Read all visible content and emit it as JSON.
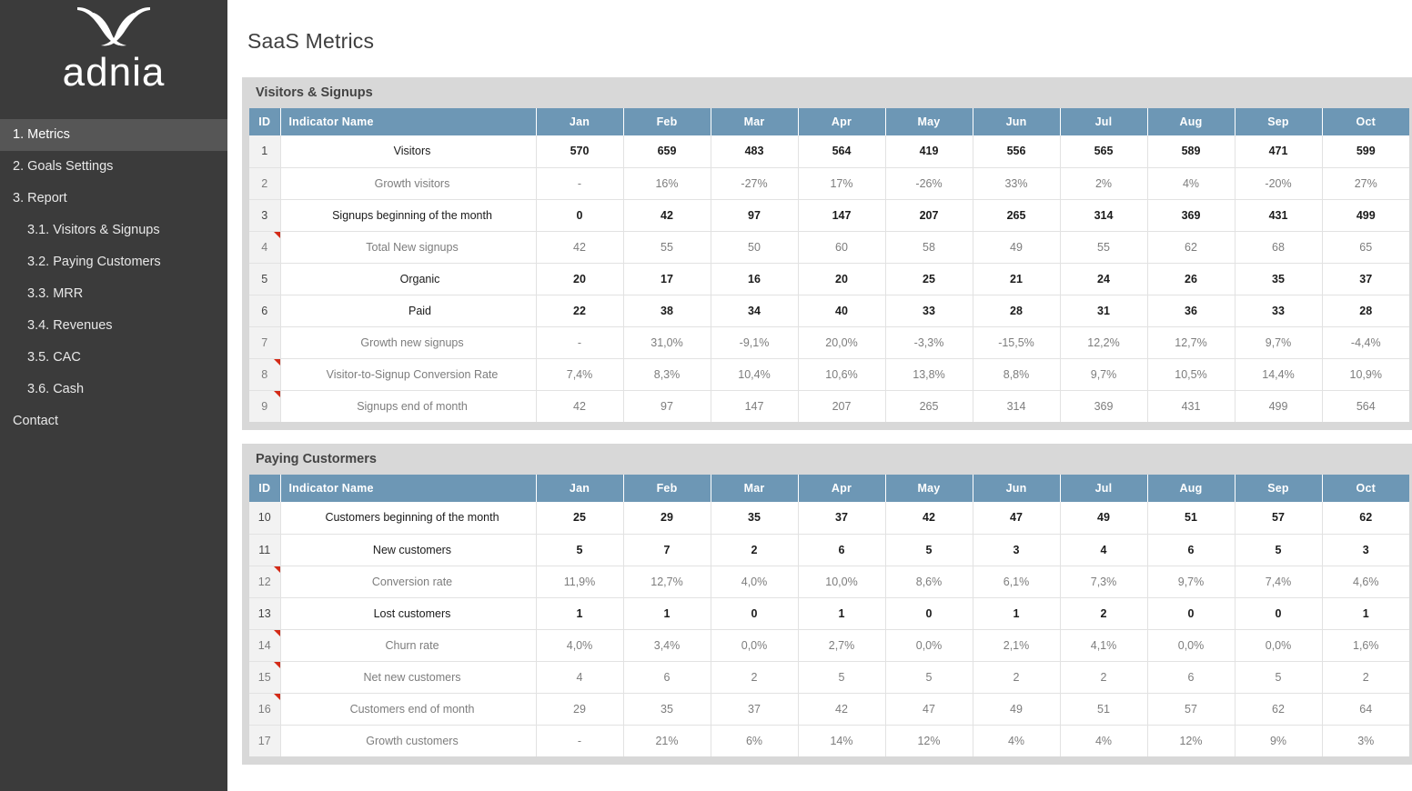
{
  "sidebar": {
    "brand": "adnia",
    "logo_icon": "adnia-ribbon-logo",
    "items": [
      {
        "label": "1. Metrics",
        "level": 0,
        "active": true
      },
      {
        "label": "2. Goals Settings",
        "level": 0,
        "active": false
      },
      {
        "label": "3. Report",
        "level": 0,
        "active": false
      },
      {
        "label": "3.1. Visitors & Signups",
        "level": 1,
        "active": false
      },
      {
        "label": "3.2. Paying Customers",
        "level": 1,
        "active": false
      },
      {
        "label": "3.3. MRR",
        "level": 1,
        "active": false
      },
      {
        "label": "3.4. Revenues",
        "level": 1,
        "active": false
      },
      {
        "label": "3.5. CAC",
        "level": 1,
        "active": false
      },
      {
        "label": "3.6. Cash",
        "level": 1,
        "active": false
      },
      {
        "label": "Contact",
        "level": 0,
        "active": false
      }
    ]
  },
  "header": {
    "title": "SaaS Metrics"
  },
  "colors": {
    "sidebar_bg": "#3b3b3b",
    "sidebar_active": "#565656",
    "panel_bg": "#d8d8d8",
    "table_header": "#6d97b5",
    "id_cell_bg": "#f2f2f2",
    "grid_line": "#e2e2e2",
    "comment_marker": "#d32a17",
    "muted_text": "#7d7d7d",
    "strong_text": "#1b1b1b"
  },
  "columns": [
    "ID",
    "Indicator Name",
    "Jan",
    "Feb",
    "Mar",
    "Apr",
    "May",
    "Jun",
    "Jul",
    "Aug",
    "Sep",
    "Oct"
  ],
  "tables": [
    {
      "title": "Visitors & Signups",
      "rows": [
        {
          "id": "1",
          "name": "Visitors",
          "emph": true,
          "comment": false,
          "indent": 0,
          "values": [
            "570",
            "659",
            "483",
            "564",
            "419",
            "556",
            "565",
            "589",
            "471",
            "599"
          ]
        },
        {
          "id": "2",
          "name": "Growth visitors",
          "emph": false,
          "comment": false,
          "indent": 0,
          "values": [
            "-",
            "16%",
            "-27%",
            "17%",
            "-26%",
            "33%",
            "2%",
            "4%",
            "-20%",
            "27%"
          ]
        },
        {
          "id": "3",
          "name": "Signups beginning of the month",
          "emph": true,
          "comment": false,
          "indent": 0,
          "values": [
            "0",
            "42",
            "97",
            "147",
            "207",
            "265",
            "314",
            "369",
            "431",
            "499"
          ]
        },
        {
          "id": "4",
          "name": "Total New signups",
          "emph": false,
          "comment": true,
          "indent": 0,
          "values": [
            "42",
            "55",
            "50",
            "60",
            "58",
            "49",
            "55",
            "62",
            "68",
            "65"
          ]
        },
        {
          "id": "5",
          "name": "Organic",
          "emph": true,
          "comment": false,
          "indent": 1,
          "values": [
            "20",
            "17",
            "16",
            "20",
            "25",
            "21",
            "24",
            "26",
            "35",
            "37"
          ]
        },
        {
          "id": "6",
          "name": "Paid",
          "emph": true,
          "comment": false,
          "indent": 1,
          "values": [
            "22",
            "38",
            "34",
            "40",
            "33",
            "28",
            "31",
            "36",
            "33",
            "28"
          ]
        },
        {
          "id": "7",
          "name": "Growth new signups",
          "emph": false,
          "comment": false,
          "indent": 0,
          "values": [
            "-",
            "31,0%",
            "-9,1%",
            "20,0%",
            "-3,3%",
            "-15,5%",
            "12,2%",
            "12,7%",
            "9,7%",
            "-4,4%"
          ]
        },
        {
          "id": "8",
          "name": "Visitor-to-Signup Conversion Rate",
          "emph": false,
          "comment": true,
          "indent": 0,
          "values": [
            "7,4%",
            "8,3%",
            "10,4%",
            "10,6%",
            "13,8%",
            "8,8%",
            "9,7%",
            "10,5%",
            "14,4%",
            "10,9%"
          ]
        },
        {
          "id": "9",
          "name": "Signups end of month",
          "emph": false,
          "comment": true,
          "indent": 0,
          "values": [
            "42",
            "97",
            "147",
            "207",
            "265",
            "314",
            "369",
            "431",
            "499",
            "564"
          ]
        }
      ]
    },
    {
      "title": "Paying Custormers",
      "rows": [
        {
          "id": "10",
          "name": "Customers beginning of the month",
          "emph": true,
          "comment": false,
          "indent": 0,
          "values": [
            "25",
            "29",
            "35",
            "37",
            "42",
            "47",
            "49",
            "51",
            "57",
            "62"
          ]
        },
        {
          "id": "11",
          "name": "New customers",
          "emph": true,
          "comment": false,
          "indent": 0,
          "values": [
            "5",
            "7",
            "2",
            "6",
            "5",
            "3",
            "4",
            "6",
            "5",
            "3"
          ]
        },
        {
          "id": "12",
          "name": "Conversion rate",
          "emph": false,
          "comment": true,
          "indent": 0,
          "values": [
            "11,9%",
            "12,7%",
            "4,0%",
            "10,0%",
            "8,6%",
            "6,1%",
            "7,3%",
            "9,7%",
            "7,4%",
            "4,6%"
          ]
        },
        {
          "id": "13",
          "name": "Lost customers",
          "emph": true,
          "comment": false,
          "indent": 0,
          "values": [
            "1",
            "1",
            "0",
            "1",
            "0",
            "1",
            "2",
            "0",
            "0",
            "1"
          ]
        },
        {
          "id": "14",
          "name": "Churn rate",
          "emph": false,
          "comment": true,
          "indent": 0,
          "values": [
            "4,0%",
            "3,4%",
            "0,0%",
            "2,7%",
            "0,0%",
            "2,1%",
            "4,1%",
            "0,0%",
            "0,0%",
            "1,6%"
          ]
        },
        {
          "id": "15",
          "name": "Net new customers",
          "emph": false,
          "comment": true,
          "indent": 0,
          "values": [
            "4",
            "6",
            "2",
            "5",
            "5",
            "2",
            "2",
            "6",
            "5",
            "2"
          ]
        },
        {
          "id": "16",
          "name": "Customers end of month",
          "emph": false,
          "comment": true,
          "indent": 0,
          "values": [
            "29",
            "35",
            "37",
            "42",
            "47",
            "49",
            "51",
            "57",
            "62",
            "64"
          ]
        },
        {
          "id": "17",
          "name": "Growth customers",
          "emph": false,
          "comment": false,
          "indent": 0,
          "values": [
            "-",
            "21%",
            "6%",
            "14%",
            "12%",
            "4%",
            "4%",
            "12%",
            "9%",
            "3%"
          ]
        }
      ]
    }
  ]
}
